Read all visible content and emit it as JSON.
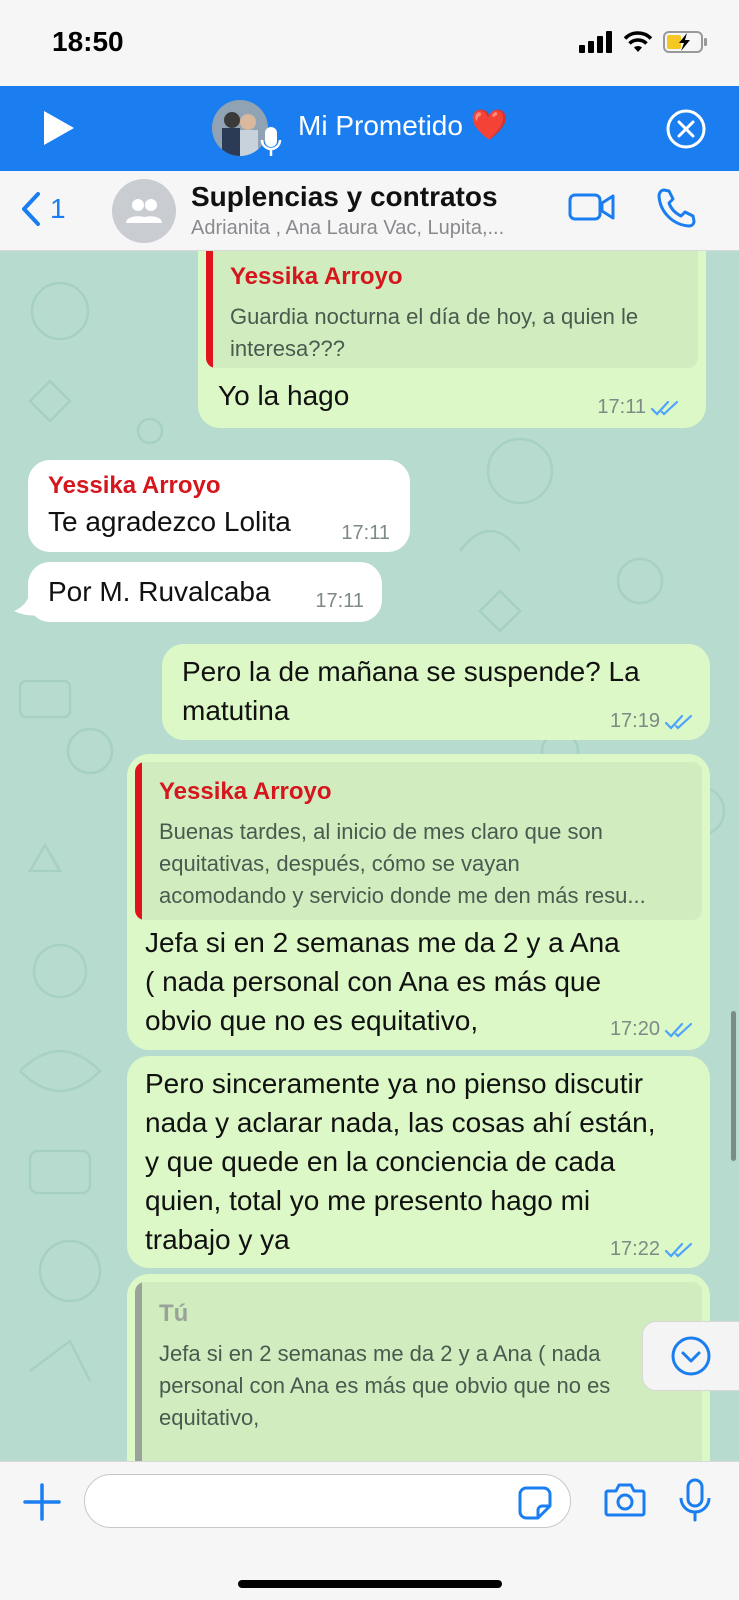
{
  "status": {
    "time": "18:50"
  },
  "call_banner": {
    "title": "Mi Prometido",
    "heart": "❤️"
  },
  "header": {
    "back_count": "1",
    "group_name": "Suplencias y contratos",
    "members": "Adrianita , Ana Laura Vac, Lupita,..."
  },
  "messages": [
    {
      "direction": "out",
      "quote_sender": "Yessika Arroyo",
      "quote_lines": [
        "Guardia nocturna el día de hoy, a quien le",
        "interesa???"
      ],
      "text": "Yo la hago",
      "time": "17:11"
    },
    {
      "direction": "in",
      "sender": "Yessika Arroyo",
      "text": "Te agradezco Lolita",
      "time": "17:11"
    },
    {
      "direction": "in",
      "text": "Por M. Ruvalcaba",
      "time": "17:11"
    },
    {
      "direction": "out",
      "lines": [
        "Pero la de mañana se suspende? La",
        "matutina"
      ],
      "time": "17:19"
    },
    {
      "direction": "out",
      "quote_sender": "Yessika Arroyo",
      "quote_lines": [
        "Buenas tardes, al inicio de mes claro que son",
        "equitativas, después, cómo se vayan",
        "acomodando y servicio donde me den más resu..."
      ],
      "lines": [
        "Jefa si en 2 semanas me da 2 y a Ana",
        "( nada personal con Ana es más que",
        "obvio que no es equitativo,"
      ],
      "time": "17:20"
    },
    {
      "direction": "out",
      "lines": [
        "Pero sinceramente ya no pienso discutir",
        "nada y aclarar nada, las cosas ahí están,",
        "y que quede en la conciencia de cada",
        "quien, total yo me presento hago mi",
        "trabajo y ya"
      ],
      "time": "17:22"
    },
    {
      "direction": "out",
      "quote_sender": "Tú",
      "quote_lines": [
        "Jefa si en 2 semanas me da 2 y a Ana ( nada",
        "personal con Ana es más que obvio que no es",
        "equitativo,"
      ]
    }
  ],
  "input": {
    "placeholder": ""
  },
  "icons": {
    "battery": "battery-charging-icon",
    "read_receipt": "double-check-icon"
  },
  "colors": {
    "accent": "#1a7ef1",
    "outgoing_bubble": "#dcf8c6",
    "incoming_bubble": "#ffffff",
    "sender_name": "#d5161d",
    "chat_background": "#b7dccf"
  }
}
